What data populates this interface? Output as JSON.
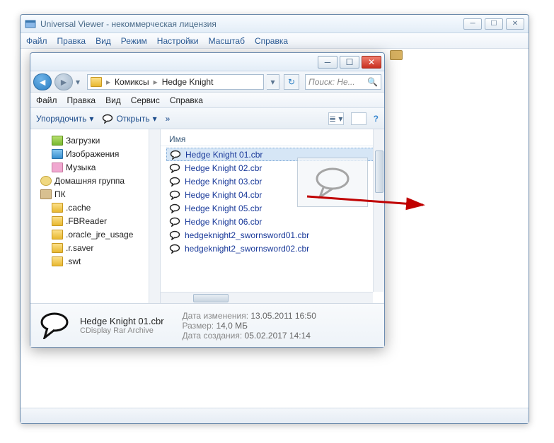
{
  "main_window": {
    "title": "Universal Viewer - некоммерческая лицензия",
    "menu": [
      "Файл",
      "Правка",
      "Вид",
      "Режим",
      "Настройки",
      "Масштаб",
      "Справка"
    ]
  },
  "explorer": {
    "nav": {
      "crumbs": [
        "Комиксы",
        "Hedge Knight"
      ],
      "search_placeholder": "Поиск: He..."
    },
    "menu": [
      "Файл",
      "Правка",
      "Вид",
      "Сервис",
      "Справка"
    ],
    "toolbar": {
      "organize": "Упорядочить",
      "open": "Открыть",
      "more": "»"
    },
    "tree": [
      {
        "icon": "dl",
        "label": "Загрузки",
        "indent": 2
      },
      {
        "icon": "img",
        "label": "Изображения",
        "indent": 2
      },
      {
        "icon": "music",
        "label": "Музыка",
        "indent": 2
      },
      {
        "icon": "group",
        "label": "Домашняя группа",
        "indent": 1
      },
      {
        "icon": "pc",
        "label": "ПК",
        "indent": 1
      },
      {
        "icon": "folder",
        "label": ".cache",
        "indent": 2
      },
      {
        "icon": "folder",
        "label": ".FBReader",
        "indent": 2
      },
      {
        "icon": "folder",
        "label": ".oracle_jre_usage",
        "indent": 2
      },
      {
        "icon": "folder",
        "label": ".r.saver",
        "indent": 2
      },
      {
        "icon": "folder",
        "label": ".swt",
        "indent": 2
      }
    ],
    "files_header": "Имя",
    "files": [
      {
        "name": "Hedge Knight 01.cbr",
        "sel": true
      },
      {
        "name": "Hedge Knight 02.cbr"
      },
      {
        "name": "Hedge Knight 03.cbr"
      },
      {
        "name": "Hedge Knight 04.cbr"
      },
      {
        "name": "Hedge Knight 05.cbr"
      },
      {
        "name": "Hedge Knight 06.cbr"
      },
      {
        "name": "hedgeknight2_swornsword01.cbr"
      },
      {
        "name": "hedgeknight2_swornsword02.cbr"
      }
    ],
    "details": {
      "name": "Hedge Knight 01.cbr",
      "type": "CDisplay Rar Archive",
      "modified_label": "Дата изменения:",
      "modified": "13.05.2011 16:50",
      "size_label": "Размер:",
      "size": "14,0 МБ",
      "created_label": "Дата создания:",
      "created": "05.02.2017 14:14"
    }
  }
}
